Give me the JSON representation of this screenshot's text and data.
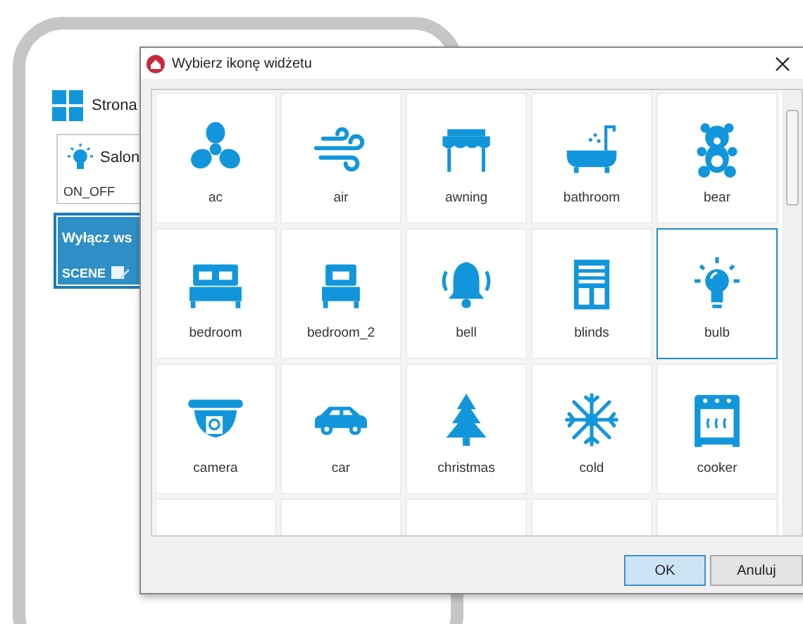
{
  "background": {
    "page_item": {
      "label": "Strona"
    },
    "widgets": [
      {
        "kind": "plain",
        "title": "Salon",
        "type": "ON_OFF"
      },
      {
        "kind": "scene",
        "title": "Wyłącz ws",
        "type": "SCENE"
      }
    ]
  },
  "dialog": {
    "title": "Wybierz ikonę widżetu",
    "icons": [
      {
        "label": "ac",
        "selected": false
      },
      {
        "label": "air",
        "selected": false
      },
      {
        "label": "awning",
        "selected": false
      },
      {
        "label": "bathroom",
        "selected": false
      },
      {
        "label": "bear",
        "selected": false
      },
      {
        "label": "bedroom",
        "selected": false
      },
      {
        "label": "bedroom_2",
        "selected": false
      },
      {
        "label": "bell",
        "selected": false
      },
      {
        "label": "blinds",
        "selected": false
      },
      {
        "label": "bulb",
        "selected": true
      },
      {
        "label": "camera",
        "selected": false
      },
      {
        "label": "car",
        "selected": false
      },
      {
        "label": "christmas",
        "selected": false
      },
      {
        "label": "cold",
        "selected": false
      },
      {
        "label": "cooker",
        "selected": false
      }
    ],
    "buttons": [
      {
        "label": "OK",
        "kind": "default"
      },
      {
        "label": "Anuluj",
        "kind": "normal"
      }
    ]
  }
}
